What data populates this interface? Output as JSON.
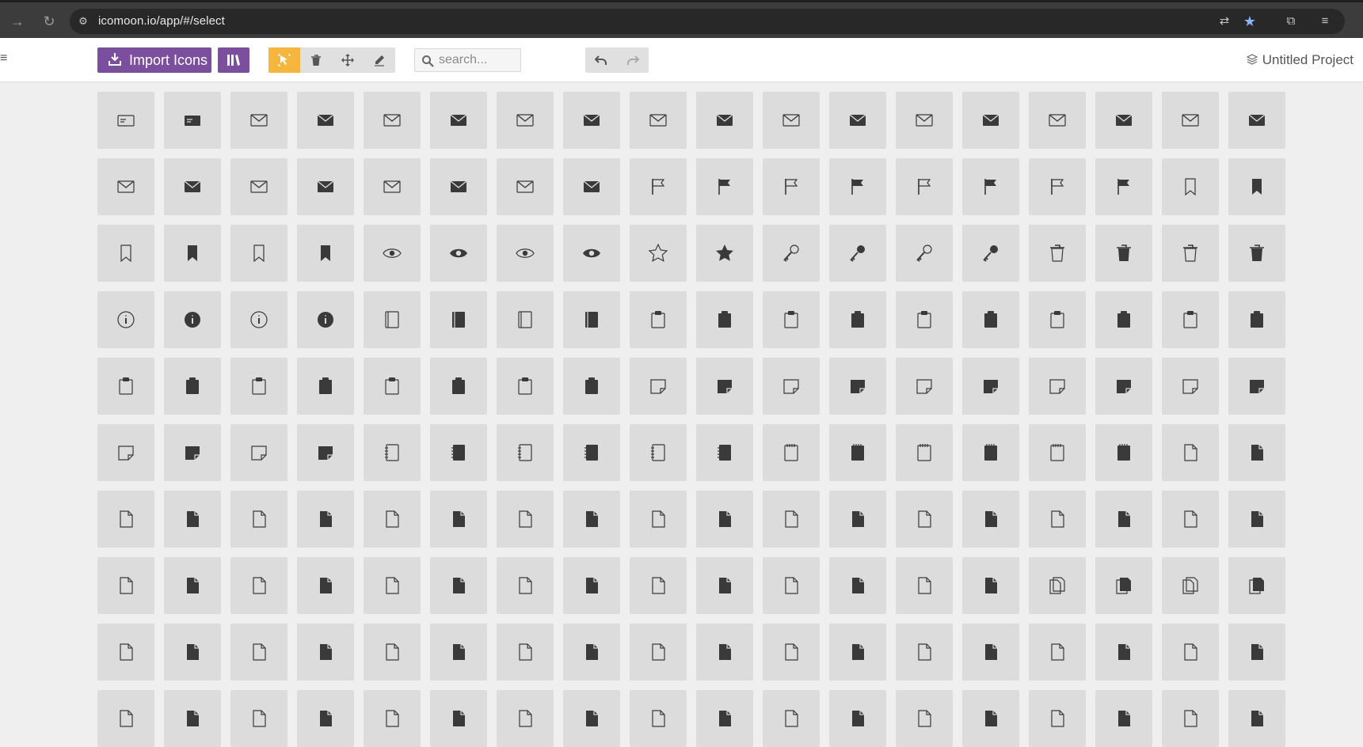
{
  "browser": {
    "url": "icomoon.io/app/#/select",
    "icons": [
      "forward-arrow-icon",
      "reload-icon",
      "site-info-icon",
      "translate-icon",
      "bookmark-star-icon",
      "extensions-icon",
      "tab-search-icon"
    ]
  },
  "toolbar": {
    "import_label": "Import Icons",
    "search_placeholder": "search...",
    "project_name": "Untitled Project",
    "accent_color": "#7b4f9d",
    "active_tool_color": "#f5b63d",
    "tools": [
      "select-tool",
      "delete-tool",
      "move-tool",
      "edit-tool"
    ]
  },
  "grid": {
    "cell_color": "#dcdcdc",
    "icon_color": "#3a3a3a",
    "rows": [
      [
        "id-card",
        "id-card",
        "envelope-open-letter",
        "envelope-open-letter",
        "envelope",
        "envelope",
        "envelope-open",
        "envelope-open",
        "envelope-open-letter",
        "envelope-open-letter",
        "envelope-lined",
        "envelope-lined",
        "envelope-open-lined",
        "envelope-open-lined",
        "envelope-warning",
        "envelope-warning",
        "envelope-check",
        "envelope-check"
      ],
      [
        "envelope-cross",
        "envelope-cross",
        "envelope-block",
        "envelope-block",
        "envelope-plus",
        "envelope-plus",
        "envelope-minus",
        "envelope-minus",
        "flag",
        "flag",
        "flag-notch",
        "flag-notch",
        "flag-pennant",
        "flag-pennant",
        "flag-square",
        "flag-square",
        "bookmark",
        "bookmark"
      ],
      [
        "bookmark-plus",
        "bookmark-plus",
        "bookmark-minus",
        "bookmark-minus",
        "eye-blocked",
        "eye-blocked",
        "eye",
        "eye",
        "star",
        "star",
        "key",
        "key",
        "key-alt",
        "key-alt",
        "trash",
        "trash",
        "trash",
        "trash"
      ],
      [
        "info",
        "info",
        "info",
        "info",
        "book",
        "book",
        "book-bookmark",
        "book-bookmark",
        "clipboard-edit",
        "clipboard-edit",
        "clipboard-plus",
        "clipboard-plus",
        "clipboard-minus",
        "clipboard-minus",
        "clipboard",
        "clipboard",
        "clipboard-down",
        "clipboard-down"
      ],
      [
        "clipboard-up",
        "clipboard-up",
        "clipboard-check",
        "clipboard-check",
        "clipboard-lines",
        "clipboard-lines",
        "clipboard-list",
        "clipboard-list",
        "note",
        "note",
        "note-plus",
        "note-plus",
        "note-minus",
        "note-minus",
        "note-lines",
        "note-lines",
        "note-list",
        "note-list"
      ],
      [
        "note-check",
        "note-check",
        "note-alert",
        "note-alert",
        "notebook",
        "notebook",
        "notebook-label",
        "notebook-label",
        "notebook-bookmark",
        "notebook-bookmark",
        "notepad",
        "notepad",
        "notepad-lines",
        "notepad-lines",
        "notepad-list",
        "notepad-list",
        "file",
        "file"
      ],
      [
        "file-text",
        "file-text",
        "file-text",
        "file-text",
        "file-download",
        "file-download",
        "file-upload",
        "file-upload",
        "file-bookmark",
        "file-bookmark",
        "file-chart",
        "file-chart",
        "file-mic",
        "file-mic",
        "file-table",
        "file-table",
        "file-music",
        "file-music"
      ],
      [
        "file-film",
        "file-film",
        "file-play",
        "file-play",
        "file-stats",
        "file-stats",
        "file-clock",
        "file-clock",
        "file-text-alt",
        "file-text-alt",
        "file-code",
        "file-code",
        "file-cloud",
        "file-cloud",
        "files",
        "files",
        "files-alt",
        "files-alt"
      ],
      [
        "file-search",
        "file-search",
        "file-star",
        "file-star",
        "file-lock",
        "file-lock",
        "file-lock-alt",
        "file-lock-alt",
        "file-warning",
        "file-warning",
        "file-cross",
        "file-cross",
        "file-check",
        "file-check",
        "file-plus",
        "file-plus",
        "file-minus",
        "file-minus"
      ],
      [
        "file",
        "file",
        "file",
        "file",
        "file",
        "file",
        "file",
        "file",
        "file",
        "file",
        "file",
        "file",
        "file",
        "file",
        "file",
        "file",
        "file",
        "file"
      ]
    ]
  }
}
